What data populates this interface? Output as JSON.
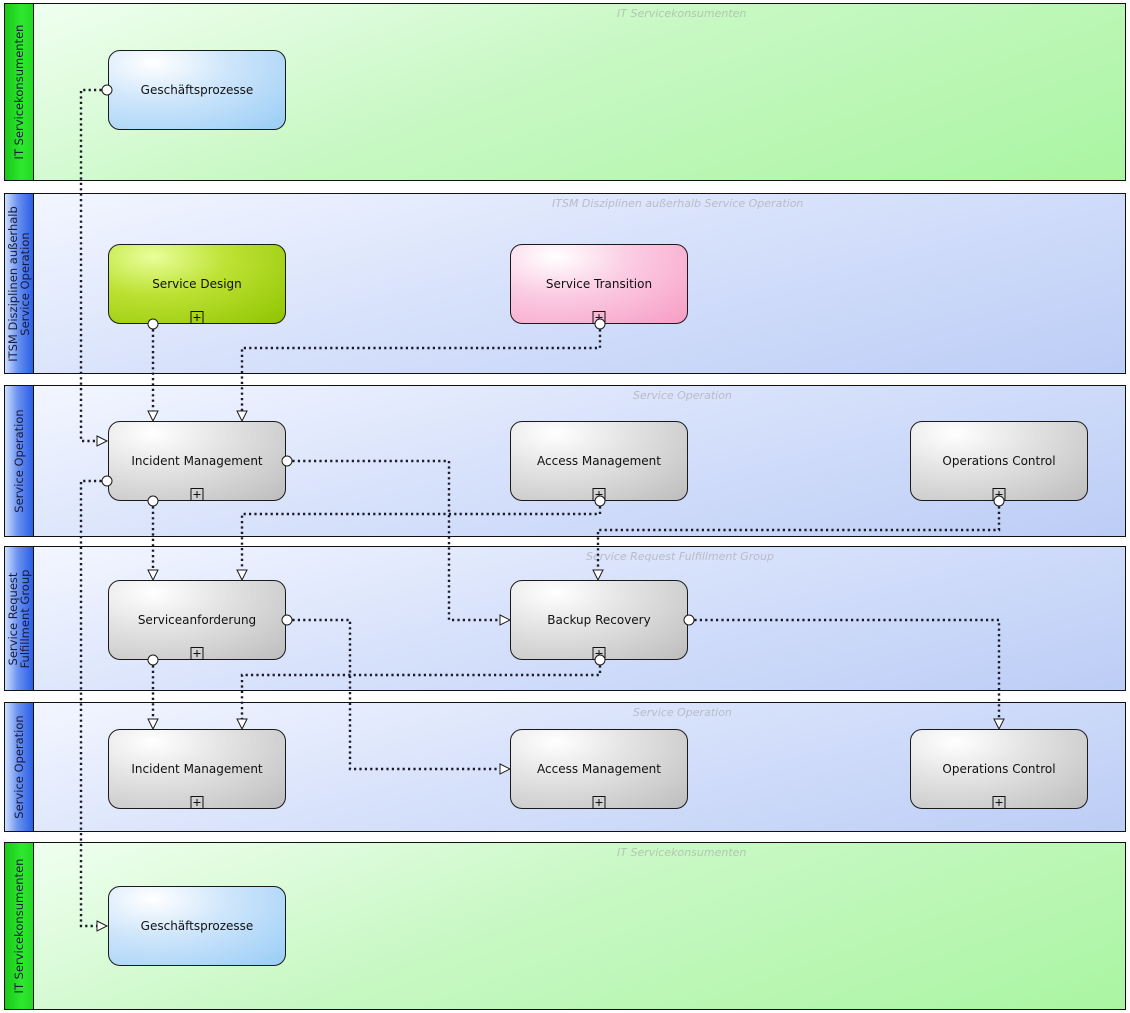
{
  "diagram": {
    "type": "BPMN swimlane diagram",
    "lanes": [
      {
        "id": "lane1",
        "header": "IT Servicekonsumenten",
        "watermark": "IT Servicekonsumenten",
        "color": "green"
      },
      {
        "id": "lane2",
        "header": "ITSM Disziplinen außerhalb\nService Operation",
        "watermark": "ITSM Disziplinen außerhalb Service Operation",
        "color": "blue"
      },
      {
        "id": "lane3",
        "header": "Service Operation",
        "watermark": "Service Operation",
        "color": "blue"
      },
      {
        "id": "lane4",
        "header": "Service Request\nFulfillment Group",
        "watermark": "Service Request Fulfillment Group",
        "color": "blue"
      },
      {
        "id": "lane5",
        "header": "Service Operation",
        "watermark": "Service Operation",
        "color": "blue"
      },
      {
        "id": "lane6",
        "header": "IT Servicekonsumenten",
        "watermark": "IT Servicekonsumenten",
        "color": "green"
      }
    ],
    "tasks": [
      {
        "id": "t1",
        "lane": "lane1",
        "label": "Geschäftsprozesse",
        "style": "blue",
        "subprocess": false
      },
      {
        "id": "t2",
        "lane": "lane2",
        "label": "Service Design",
        "style": "lime",
        "subprocess": true
      },
      {
        "id": "t3",
        "lane": "lane2",
        "label": "Service Transition",
        "style": "pink",
        "subprocess": true
      },
      {
        "id": "t4",
        "lane": "lane3",
        "label": "Incident Management",
        "style": "grey",
        "subprocess": true
      },
      {
        "id": "t5",
        "lane": "lane3",
        "label": "Access Management",
        "style": "grey",
        "subprocess": true
      },
      {
        "id": "t6",
        "lane": "lane3",
        "label": "Operations Control",
        "style": "grey",
        "subprocess": true
      },
      {
        "id": "t7",
        "lane": "lane4",
        "label": "Serviceanforderung",
        "style": "grey",
        "subprocess": true
      },
      {
        "id": "t8",
        "lane": "lane4",
        "label": "Backup Recovery",
        "style": "grey",
        "subprocess": true
      },
      {
        "id": "t9",
        "lane": "lane5",
        "label": "Incident Management",
        "style": "grey",
        "subprocess": true
      },
      {
        "id": "t10",
        "lane": "lane5",
        "label": "Access Management",
        "style": "grey",
        "subprocess": true
      },
      {
        "id": "t11",
        "lane": "lane5",
        "label": "Operations Control",
        "style": "grey",
        "subprocess": true
      },
      {
        "id": "t12",
        "lane": "lane6",
        "label": "Geschäftsprozesse",
        "style": "blue",
        "subprocess": false
      }
    ],
    "connections": [
      {
        "from": "t1",
        "to": "t4",
        "type": "message-flow"
      },
      {
        "from": "t2",
        "to": "t4",
        "type": "message-flow"
      },
      {
        "from": "t3",
        "to": "t4",
        "type": "message-flow"
      },
      {
        "from": "t4",
        "to": "t8",
        "type": "message-flow"
      },
      {
        "from": "t4",
        "to": "t7",
        "type": "message-flow"
      },
      {
        "from": "t4",
        "to": "t12",
        "type": "message-flow"
      },
      {
        "from": "t5",
        "to": "t7",
        "type": "message-flow"
      },
      {
        "from": "t6",
        "to": "t8",
        "type": "message-flow"
      },
      {
        "from": "t7",
        "to": "t9",
        "type": "message-flow"
      },
      {
        "from": "t7",
        "to": "t10",
        "type": "message-flow"
      },
      {
        "from": "t8",
        "to": "t9",
        "type": "message-flow"
      },
      {
        "from": "t8",
        "to": "t11",
        "type": "message-flow"
      }
    ],
    "colors": {
      "lane_green": "#b4f7ae",
      "lane_header_green": "#22dd22",
      "lane_blue": "#c8d6f8",
      "lane_header_blue": "#2a5fe6",
      "task_grey": "#c8c8c8",
      "task_blue": "#a8d4f8",
      "task_lime": "#a4d000",
      "task_pink": "#f9a8cf",
      "connector": "#1a1a2a"
    }
  }
}
